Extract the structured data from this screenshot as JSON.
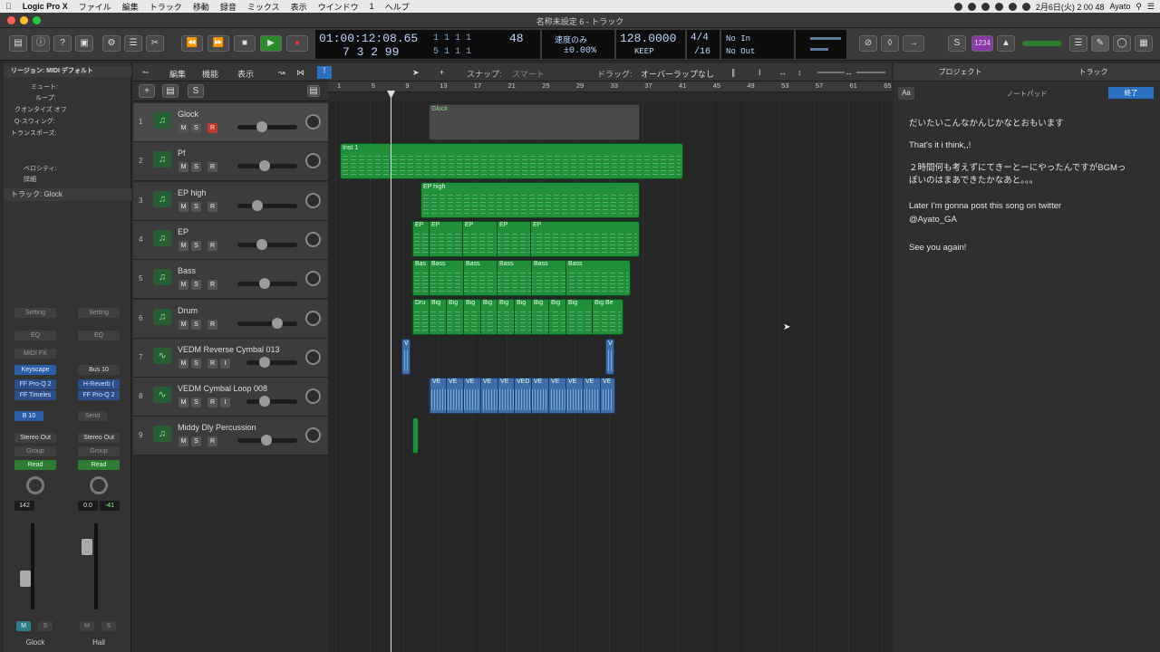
{
  "menubar": {
    "app": "Logic Pro X",
    "items": [
      "ファイル",
      "編集",
      "トラック",
      "移動",
      "録音",
      "ミックス",
      "表示",
      "ウインドウ",
      "1",
      "ヘルプ"
    ],
    "clock": "2月6日(火) 2 00 48",
    "user": "Ayato"
  },
  "window": {
    "title": "名称未設定 6 - トラック"
  },
  "lcd": {
    "time": "01:00:12:08.65",
    "bars_top": "1   1   1     1",
    "bars_bot": "7  3  2    99",
    "bars_right_top": "48",
    "bars_right_bot": "5  1  1     1",
    "tempo_label": "速度のみ",
    "tempo_pct": "±0.00%",
    "bpm": "128.0000",
    "keep": "KEEP",
    "sig_top": "4/4",
    "sig_bot": "/16",
    "in": "No In",
    "out": "No Out",
    "count": "1234"
  },
  "tracks_toolbar": {
    "edit": "編集",
    "functions": "機能",
    "view": "表示",
    "snap_label": "スナップ:",
    "snap_value": "スマート",
    "drag_label": "ドラッグ:",
    "drag_value": "オーバーラップなし"
  },
  "inspector": {
    "region_label": "リージョン:",
    "region_value": "MIDI デフォルト",
    "mute": "ミュート:",
    "loop": "ループ:",
    "quantize": "クオンタイズ",
    "quantize_val": "オフ",
    "qswing": "Q-スウィング:",
    "transpose": "トランスポーズ:",
    "velocity": "ベロシティ:",
    "detail": "詳細",
    "track_label": "トラック:",
    "track_value": "Glock"
  },
  "strips": [
    {
      "setting": "Setting",
      "eq": "EQ",
      "midifx": "MIDI FX",
      "inst": "Keyscape",
      "fx1": "FF Pro-Q 2",
      "fx2": "FF Timeles",
      "send": "B 10",
      "out": "Stereo Out",
      "group": "Group",
      "auto": "Read",
      "val1": "142",
      "val2": "",
      "name": "Glock"
    },
    {
      "setting": "Setting",
      "eq": "EQ",
      "midifx": "",
      "inst": "Bus 10",
      "fx1": "H-Reverb (",
      "fx2": "FF Pro-Q 2",
      "send": "Send",
      "out": "Stereo Out",
      "group": "Group",
      "auto": "Read",
      "val1": "0.0",
      "val2": "-41",
      "name": "Hall"
    }
  ],
  "ruler": [
    "1",
    "5",
    "9",
    "13",
    "17",
    "21",
    "25",
    "29",
    "33",
    "37",
    "41",
    "45",
    "49",
    "53",
    "57",
    "61",
    "65"
  ],
  "tracks": [
    {
      "num": "1",
      "name": "Glock",
      "type": "midi"
    },
    {
      "num": "2",
      "name": "Pf",
      "type": "midi"
    },
    {
      "num": "3",
      "name": "EP high",
      "type": "midi"
    },
    {
      "num": "4",
      "name": "EP",
      "type": "midi"
    },
    {
      "num": "5",
      "name": "Bass",
      "type": "midi"
    },
    {
      "num": "6",
      "name": "Drum",
      "type": "midi"
    },
    {
      "num": "7",
      "name": "VEDM Reverse Cymbal 013",
      "type": "audio"
    },
    {
      "num": "8",
      "name": "VEDM Cymbal Loop 008",
      "type": "audio"
    },
    {
      "num": "9",
      "name": "Middy Dly Percussion",
      "type": "midi"
    }
  ],
  "regions": {
    "glock": "Glock",
    "pf": "Inst 1",
    "ephigh": "EP high",
    "ep": [
      "EP",
      "EP",
      "EP",
      "EP",
      "EP"
    ],
    "bass": [
      "Bas",
      "Bass",
      "Bass",
      "Bass",
      "Bass",
      "Bass"
    ],
    "drum": [
      "Dru",
      "Big",
      "Big",
      "Big",
      "Big",
      "Big",
      "Big",
      "Big",
      "Big",
      "Big",
      "Big Be"
    ],
    "rev": [
      "V",
      "V"
    ],
    "cym": [
      "VE",
      "VE",
      "VE",
      "VE",
      "VE",
      "VED",
      "VE",
      "VE",
      "VE",
      "VE",
      "VE"
    ]
  },
  "notepad": {
    "tab_project": "プロジェクト",
    "tab_track": "トラック",
    "aa": "Aa",
    "title": "ノートパッド",
    "done": "終了",
    "lines": [
      "だいたいこんなかんじかなとおもいます",
      "That's it i think,,!",
      "２時間何も考えずにてきーとーにやったんですがBGMっ",
      "ぽいのはまあできたかなあと。。。",
      "Later I'm gonna post this song on twitter",
      "@Ayato_GA",
      "See you again!"
    ]
  }
}
